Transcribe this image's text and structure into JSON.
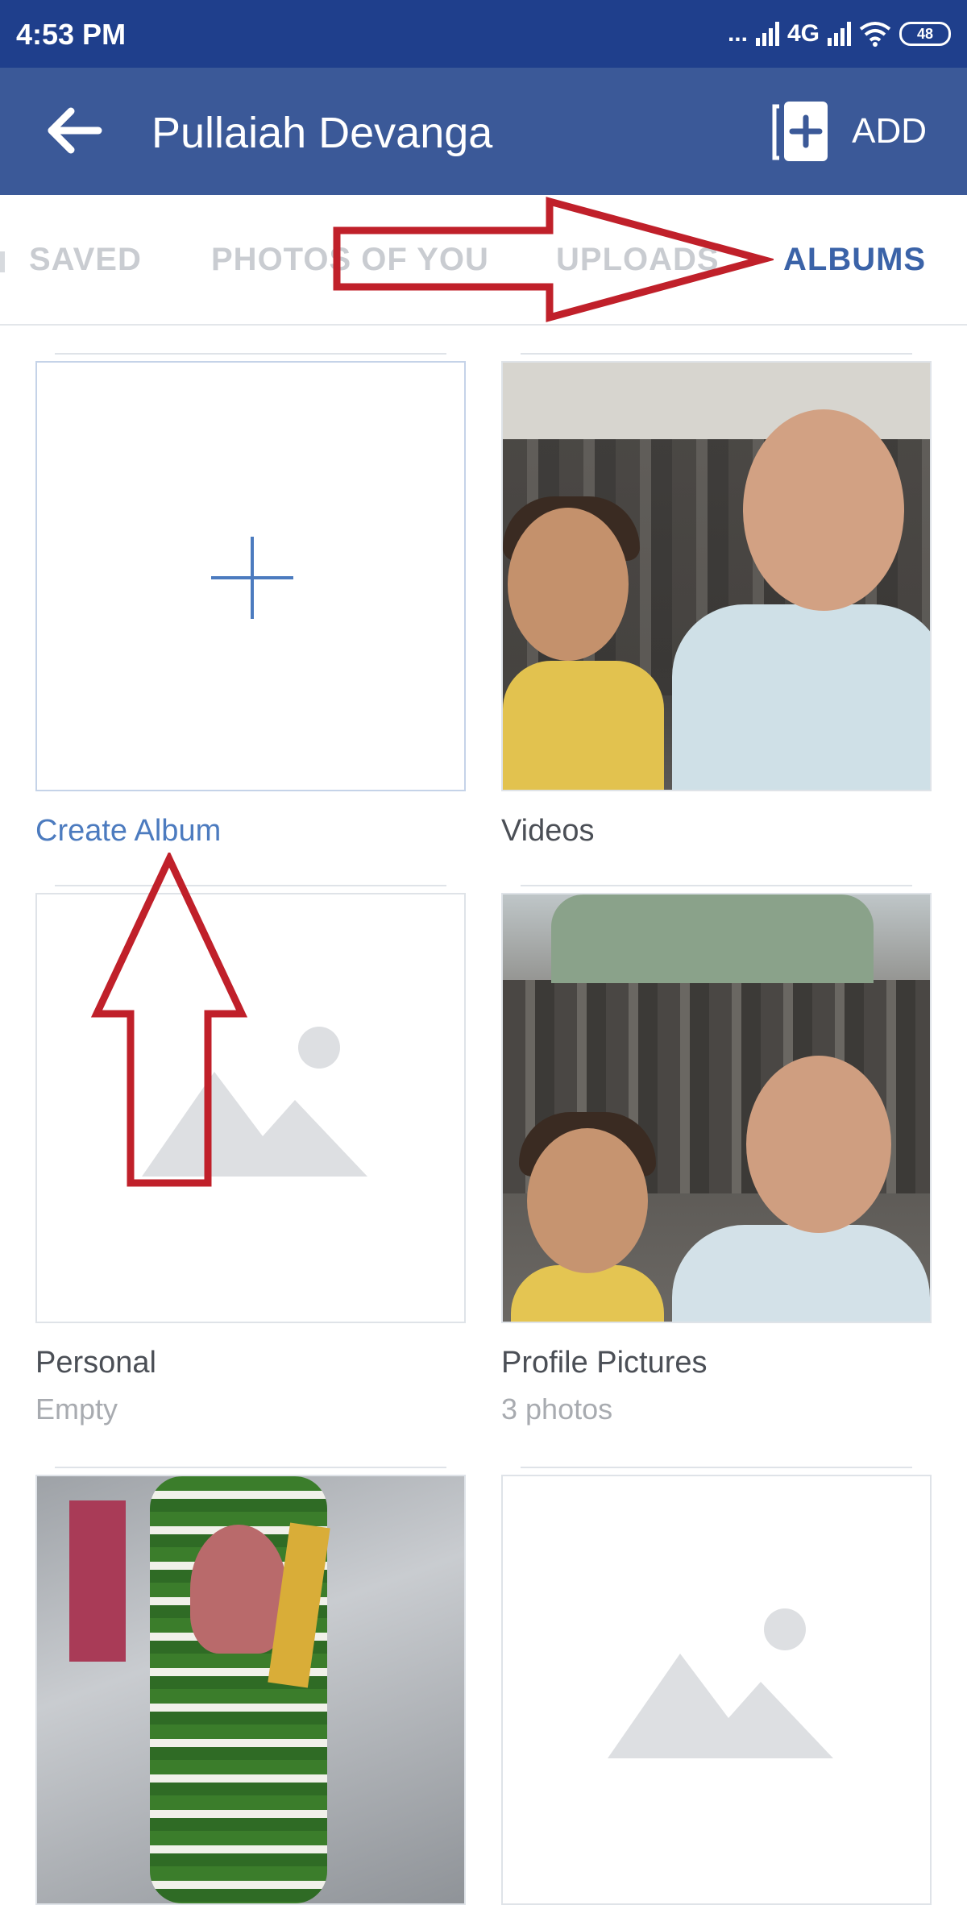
{
  "status_bar": {
    "time": "4:53 PM",
    "dots": "...",
    "network_label": "4G",
    "battery": "48"
  },
  "app_bar": {
    "title": "Pullaiah Devanga",
    "add_label": "ADD"
  },
  "tabs": [
    {
      "label": "SAVED",
      "active": false
    },
    {
      "label": "PHOTOS OF YOU",
      "active": false
    },
    {
      "label": "UPLOADS",
      "active": false
    },
    {
      "label": "ALBUMS",
      "active": true
    }
  ],
  "albums": [
    {
      "title": "Create Album",
      "subtitle": "",
      "kind": "create"
    },
    {
      "title": "Videos",
      "subtitle": "",
      "kind": "photo"
    },
    {
      "title": "Personal",
      "subtitle": "Empty",
      "kind": "empty"
    },
    {
      "title": "Profile Pictures",
      "subtitle": "3 photos",
      "kind": "photo"
    },
    {
      "title": "",
      "subtitle": "",
      "kind": "photo"
    },
    {
      "title": "",
      "subtitle": "",
      "kind": "empty"
    }
  ],
  "colors": {
    "status_bar": "#1f3f8c",
    "app_bar": "#3b5998",
    "active_tab": "#3b63a8",
    "inactive_tab": "#c9ccd1",
    "annotation_arrow": "#c0202a"
  }
}
